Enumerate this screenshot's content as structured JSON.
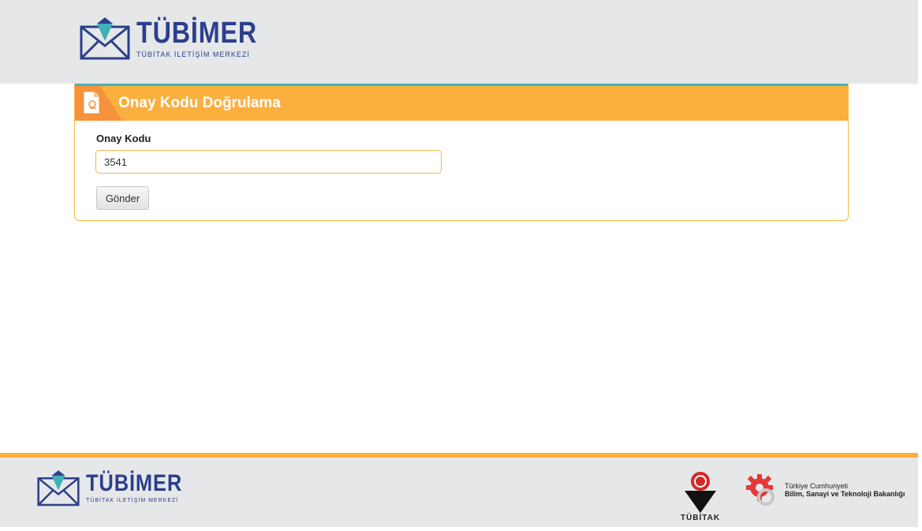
{
  "header": {
    "brand_name": "TÜBİMER",
    "brand_subtitle": "TÜBİTAK İLETİŞİM MERKEZİ"
  },
  "card": {
    "title": "Onay Kodu Doğrulama",
    "field_label": "Onay Kodu",
    "code_value": "3541",
    "submit_label": "Gönder"
  },
  "footer": {
    "brand_name": "TÜBİMER",
    "brand_subtitle": "TÜBİTAK İLETİŞİM MERKEZİ",
    "tubitak_label": "TÜBİTAK",
    "ministry_line1": "Türkiye Cumhuriyeti",
    "ministry_line2": "Bilim, Sanayi ve Teknoloji Bakanlığı"
  },
  "colors": {
    "brand_blue": "#2b3f8c",
    "accent_orange": "#fbaf3e",
    "accent_teal": "#42b5bb",
    "header_gray": "#e6e7e9"
  },
  "icons": {
    "brand_logo": "envelope-heart-icon",
    "card_icon": "document-icon",
    "tubitak_logo": "tubitak-logo",
    "ministry_logo": "gear-logo"
  }
}
